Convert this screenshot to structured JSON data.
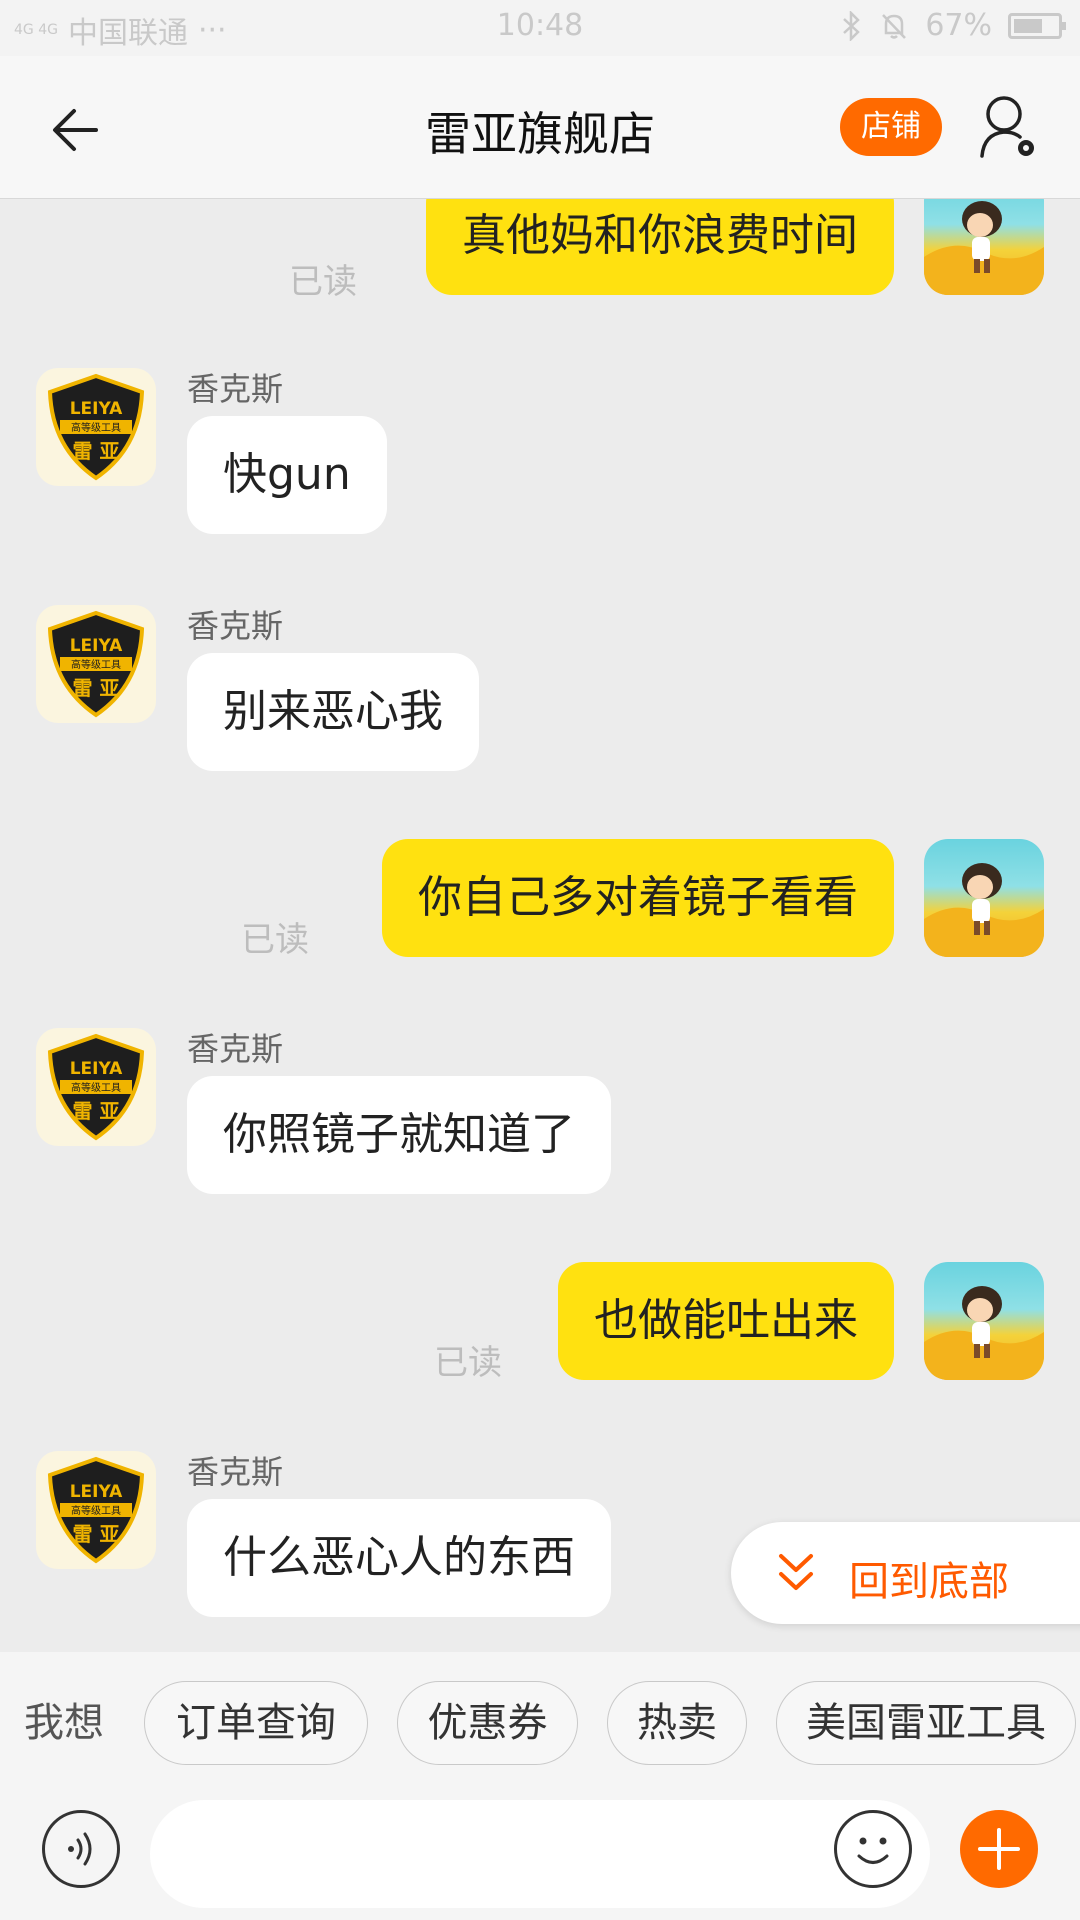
{
  "status_bar": {
    "signal": "4G 4G",
    "carrier": "中国联通",
    "dots": "···",
    "time": "10:48",
    "battery": "67%"
  },
  "header": {
    "title": "雷亚旗舰店",
    "store_button": "店铺"
  },
  "shop": {
    "logo_text_top": "LEIYA",
    "logo_text_mid": "高等级工具",
    "logo_text_bottom": "雷 亚"
  },
  "messages": [
    {
      "side": "out",
      "text": "真他妈和你浪费时间",
      "read": "已读"
    },
    {
      "side": "in",
      "sender": "香克斯",
      "text": "快gun"
    },
    {
      "side": "in",
      "sender": "香克斯",
      "text": "别来恶心我"
    },
    {
      "side": "out",
      "text": "你自己多对着镜子看看",
      "read": "已读"
    },
    {
      "side": "in",
      "sender": "香克斯",
      "text": "你照镜子就知道了"
    },
    {
      "side": "out",
      "text": "也做能吐出来",
      "read": "已读"
    },
    {
      "side": "in",
      "sender": "香克斯",
      "text": "什么恶心人的东西"
    }
  ],
  "scroll_to_bottom": "回到底部",
  "quick_replies": {
    "label": "我想",
    "chips": [
      "订单查询",
      "优惠券",
      "热卖",
      "美国雷亚工具"
    ]
  },
  "input": {
    "placeholder": ""
  },
  "colors": {
    "accent": "#ff6a00",
    "outgoing_bubble": "#ffe110",
    "incoming_bubble": "#ffffff",
    "background": "#ececec"
  }
}
